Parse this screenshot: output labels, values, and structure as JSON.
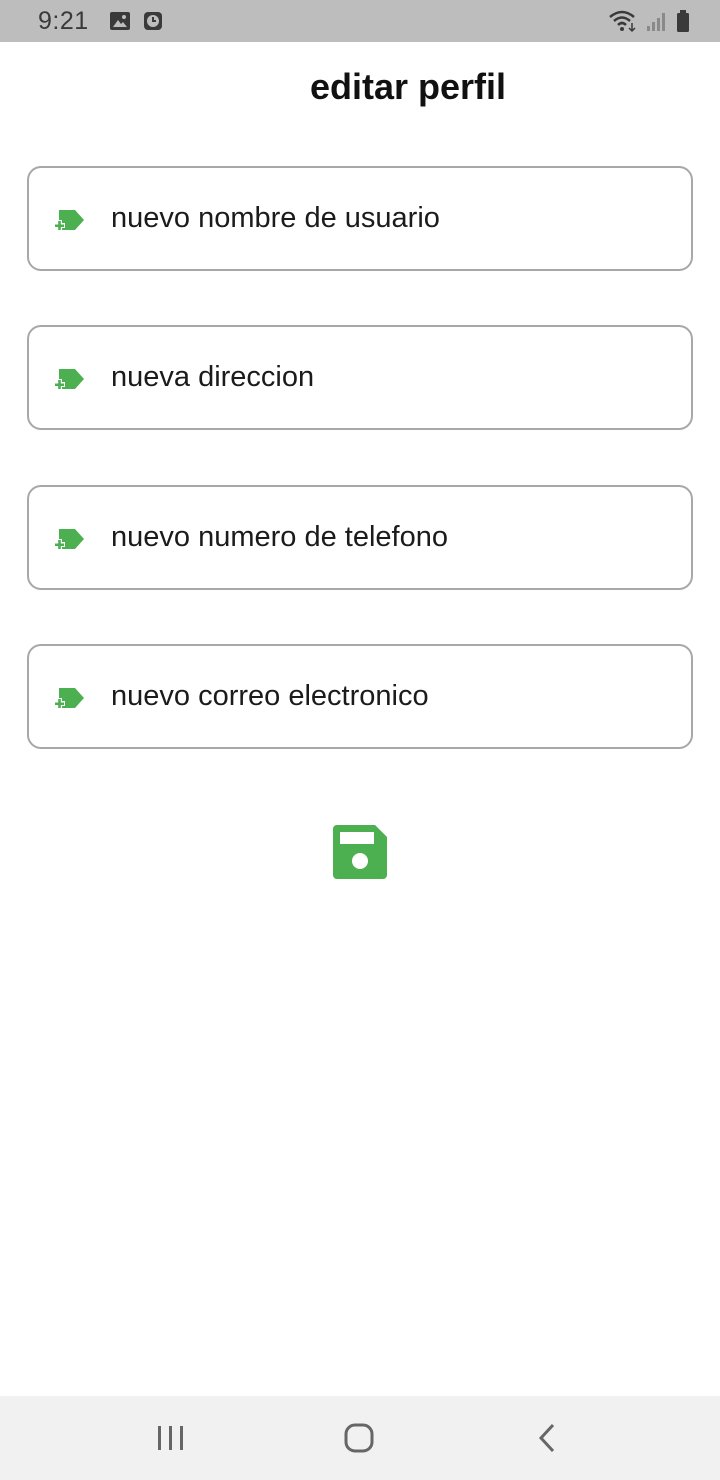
{
  "status_bar": {
    "time": "9:21",
    "left_icons": [
      "image-icon",
      "clock-icon"
    ],
    "right_icons": [
      "wifi-icon",
      "signal-icon",
      "battery-icon"
    ]
  },
  "page": {
    "title": "editar perfil"
  },
  "form": {
    "fields": [
      {
        "placeholder": "nuevo nombre de usuario",
        "value": "",
        "icon": "tag-add-icon"
      },
      {
        "placeholder": "nueva direccion",
        "value": "",
        "icon": "tag-add-icon"
      },
      {
        "placeholder": "nuevo numero de telefono",
        "value": "",
        "icon": "tag-add-icon"
      },
      {
        "placeholder": "nuevo correo electronico",
        "value": "",
        "icon": "tag-add-icon"
      }
    ],
    "save_icon": "floppy-disk-icon"
  },
  "nav_bar": {
    "buttons": [
      "recent-apps-icon",
      "home-icon",
      "back-icon"
    ]
  },
  "colors": {
    "accent": "#4caf50",
    "status_bar_bg": "#bdbdbd",
    "nav_bar_bg": "#f1f1f1",
    "field_border": "#a8a8a8"
  }
}
